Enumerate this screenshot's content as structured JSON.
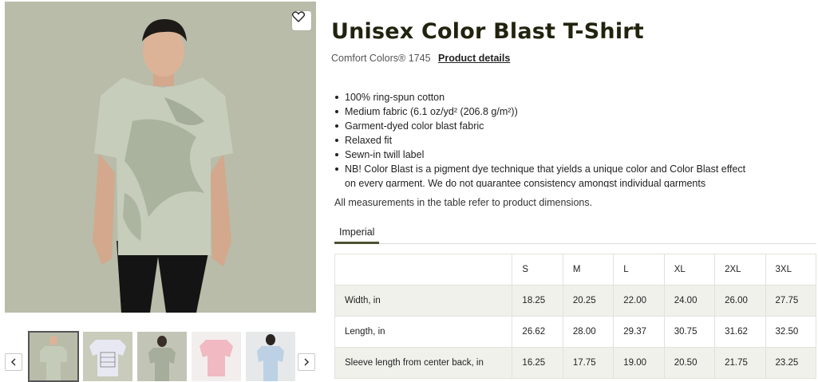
{
  "product": {
    "title": "Unisex Color Blast T-Shirt",
    "brand": "Comfort Colors® 1745",
    "details_link": "Product details",
    "features": [
      "100% ring-spun cotton",
      "Medium fabric (6.1 oz/yd² (206.8 g/m²))",
      "Garment-dyed color blast fabric",
      "Relaxed fit",
      "Sewn-in twill label",
      "NB! Color Blast is a pigment dye technique that yields a unique color and Color Blast effect on every garment. We do not guarantee consistency amongst individual garments"
    ],
    "measurement_note": "All measurements in the table refer to product dimensions."
  },
  "size_guide": {
    "tabs": [
      "Imperial"
    ],
    "sizes": [
      "S",
      "M",
      "L",
      "XL",
      "2XL",
      "3XL"
    ],
    "rows": [
      {
        "label": "Width, in",
        "values": [
          "18.25",
          "20.25",
          "22.00",
          "24.00",
          "26.00",
          "27.75"
        ]
      },
      {
        "label": "Length, in",
        "values": [
          "26.62",
          "28.00",
          "29.37",
          "30.75",
          "31.62",
          "32.50"
        ]
      },
      {
        "label": "Sleeve length from center back, in",
        "values": [
          "16.25",
          "17.75",
          "19.00",
          "20.50",
          "21.75",
          "23.25"
        ]
      }
    ]
  },
  "gallery": {
    "favorite_icon": "heart-icon",
    "prev_icon": "chevron-left-icon",
    "next_icon": "chevron-right-icon",
    "thumbnails": [
      {
        "name": "thumb-model-front-sage",
        "active": true
      },
      {
        "name": "thumb-size-chart",
        "active": false
      },
      {
        "name": "thumb-model-woman-sage",
        "active": false
      },
      {
        "name": "thumb-pink-shirt",
        "active": false
      },
      {
        "name": "thumb-model-blue-back",
        "active": false
      }
    ]
  },
  "colors": {
    "title": "#22230f",
    "tab_underline": "#4b5230",
    "table_shade": "#f1f1ec",
    "image_bg": "#b9bdaa"
  }
}
